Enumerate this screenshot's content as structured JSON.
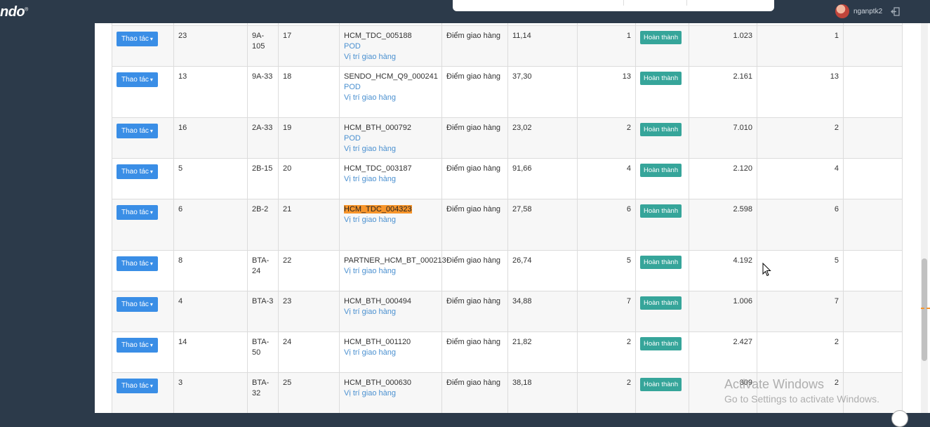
{
  "header": {
    "logo_text": "ndo",
    "logo_mark": "®",
    "username": "nganptk2"
  },
  "table": {
    "rows": [
      {
        "action": "Thao tác",
        "c1": "23",
        "c2": "9A-105",
        "c3": "17",
        "code": "HCM_TDC_005188",
        "pod": "POD",
        "location_link": "Vị trí giao hàng",
        "type": "Điểm giao hàng",
        "dist": "11,14",
        "qty": "1",
        "status": "Hoàn thành",
        "amount": "1.023",
        "count": "1"
      },
      {
        "action": "Thao tác",
        "c1": "13",
        "c2": "9A-33",
        "c3": "18",
        "code": "SENDO_HCM_Q9_000241",
        "pod": "POD",
        "location_link": "Vị trí giao hàng",
        "type": "Điểm giao hàng",
        "dist": "37,30",
        "qty": "13",
        "status": "Hoàn thành",
        "amount": "2.161",
        "count": "13"
      },
      {
        "action": "Thao tác",
        "c1": "16",
        "c2": "2A-33",
        "c3": "19",
        "code": "HCM_BTH_000792",
        "pod": "POD",
        "location_link": "Vị trí giao hàng",
        "type": "Điểm giao hàng",
        "dist": "23,02",
        "qty": "2",
        "status": "Hoàn thành",
        "amount": "7.010",
        "count": "2"
      },
      {
        "action": "Thao tác",
        "c1": "5",
        "c2": "2B-15",
        "c3": "20",
        "code": "HCM_TDC_003187",
        "location_link": "Vị trí giao hàng",
        "type": "Điểm giao hàng",
        "dist": "91,66",
        "qty": "4",
        "status": "Hoàn thành",
        "amount": "2.120",
        "count": "4"
      },
      {
        "action": "Thao tác",
        "c1": "6",
        "c2": "2B-2",
        "c3": "21",
        "code": "HCM_TDC_004323",
        "location_link": "Vị trí giao hàng",
        "type": "Điểm giao hàng",
        "dist": "27,58",
        "qty": "6",
        "status": "Hoàn thành",
        "amount": "2.598",
        "count": "6"
      },
      {
        "action": "Thao tác",
        "c1": "8",
        "c2": "BTA-24",
        "c3": "22",
        "code": "PARTNER_HCM_BT_000213",
        "location_link": "Vị trí giao hàng",
        "type": "Điểm giao hàng",
        "dist": "26,74",
        "qty": "5",
        "status": "Hoàn thành",
        "amount": "4.192",
        "count": "5"
      },
      {
        "action": "Thao tác",
        "c1": "4",
        "c2": "BTA-3",
        "c3": "23",
        "code": "HCM_BTH_000494",
        "location_link": "Vị trí giao hàng",
        "type": "Điểm giao hàng",
        "dist": "34,88",
        "qty": "7",
        "status": "Hoàn thành",
        "amount": "1.006",
        "count": "7"
      },
      {
        "action": "Thao tác",
        "c1": "14",
        "c2": "BTA-50",
        "c3": "24",
        "code": "HCM_BTH_001120",
        "location_link": "Vị trí giao hàng",
        "type": "Điểm giao hàng",
        "dist": "21,82",
        "qty": "2",
        "status": "Hoàn thành",
        "amount": "2.427",
        "count": "2"
      },
      {
        "action": "Thao tác",
        "c1": "3",
        "c2": "BTA-32",
        "c3": "25",
        "code": "HCM_BTH_000630",
        "location_link": "Vị trí giao hàng",
        "type": "Điểm giao hàng",
        "dist": "38,18",
        "qty": "2",
        "status": "Hoàn thành",
        "amount": "309",
        "count": "2"
      }
    ]
  },
  "watermark": {
    "line1": "Activate Windows",
    "line2": "Go to Settings to activate Windows."
  },
  "colors": {
    "sidebar_bg": "#2c3a4a",
    "button_blue": "#3a8ee6",
    "badge_teal": "#36a59a",
    "highlight_orange": "#f7952b",
    "link_blue": "#4a90d0"
  }
}
